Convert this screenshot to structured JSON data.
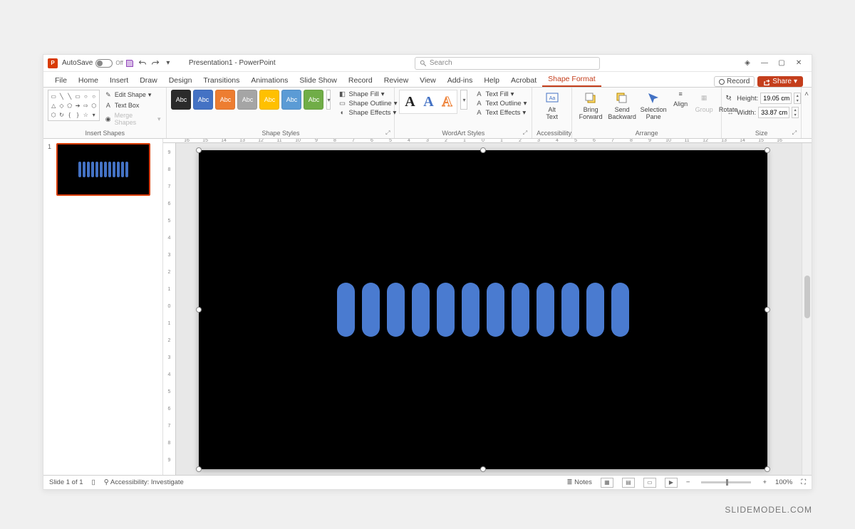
{
  "titlebar": {
    "autosave_label": "AutoSave",
    "autosave_state": "Off",
    "doc_title": "Presentation1 - PowerPoint",
    "search_placeholder": "Search"
  },
  "tabs": {
    "items": [
      "File",
      "Home",
      "Insert",
      "Draw",
      "Design",
      "Transitions",
      "Animations",
      "Slide Show",
      "Record",
      "Review",
      "View",
      "Add-ins",
      "Help",
      "Acrobat",
      "Shape Format"
    ],
    "active_index": 14,
    "record_label": "Record",
    "share_label": "Share"
  },
  "ribbon": {
    "insert_shapes": {
      "label": "Insert Shapes",
      "edit_shape": "Edit Shape",
      "text_box": "Text Box",
      "merge_shapes": "Merge Shapes"
    },
    "shape_styles": {
      "label": "Shape Styles",
      "swatch_text": "Abc",
      "swatches": [
        {
          "bg": "#2b2b2b"
        },
        {
          "bg": "#4472c4"
        },
        {
          "bg": "#ed7d31"
        },
        {
          "bg": "#a5a5a5"
        },
        {
          "bg": "#ffc000"
        },
        {
          "bg": "#5b9bd5"
        },
        {
          "bg": "#70ad47"
        }
      ],
      "fill": "Shape Fill",
      "outline": "Shape Outline",
      "effects": "Shape Effects"
    },
    "wordart": {
      "label": "WordArt Styles",
      "samples": [
        {
          "color": "#222",
          "stroke": "none"
        },
        {
          "color": "#4472c4",
          "stroke": "none"
        },
        {
          "color": "#ed7d31",
          "stroke": "#ed7d31"
        }
      ],
      "text_fill": "Text Fill",
      "text_outline": "Text Outline",
      "text_effects": "Text Effects"
    },
    "accessibility": {
      "label": "Accessibility",
      "alt_text": "Alt\nText"
    },
    "arrange": {
      "label": "Arrange",
      "bring_forward": "Bring\nForward",
      "send_backward": "Send\nBackward",
      "selection_pane": "Selection\nPane",
      "align": "Align",
      "group": "Group",
      "rotate": "Rotate"
    },
    "size": {
      "label": "Size",
      "height_label": "Height:",
      "width_label": "Width:",
      "height_value": "19.05 cm",
      "width_value": "33.87 cm"
    }
  },
  "ruler_h": [
    "16",
    "15",
    "14",
    "13",
    "12",
    "11",
    "10",
    "9",
    "8",
    "7",
    "6",
    "5",
    "4",
    "3",
    "2",
    "1",
    "0",
    "1",
    "2",
    "3",
    "4",
    "5",
    "6",
    "7",
    "8",
    "9",
    "10",
    "11",
    "12",
    "13",
    "14",
    "15",
    "16"
  ],
  "ruler_v": [
    "9",
    "8",
    "7",
    "6",
    "5",
    "4",
    "3",
    "2",
    "1",
    "0",
    "1",
    "2",
    "3",
    "4",
    "5",
    "6",
    "7",
    "8",
    "9"
  ],
  "thumbnail": {
    "number": "1",
    "pill_count": 12
  },
  "slide": {
    "pill_count": 12
  },
  "status": {
    "slide_info": "Slide 1 of 1",
    "accessibility": "Accessibility: Investigate",
    "notes": "Notes",
    "zoom": "100%"
  },
  "watermark": "SLIDEMODEL.COM"
}
